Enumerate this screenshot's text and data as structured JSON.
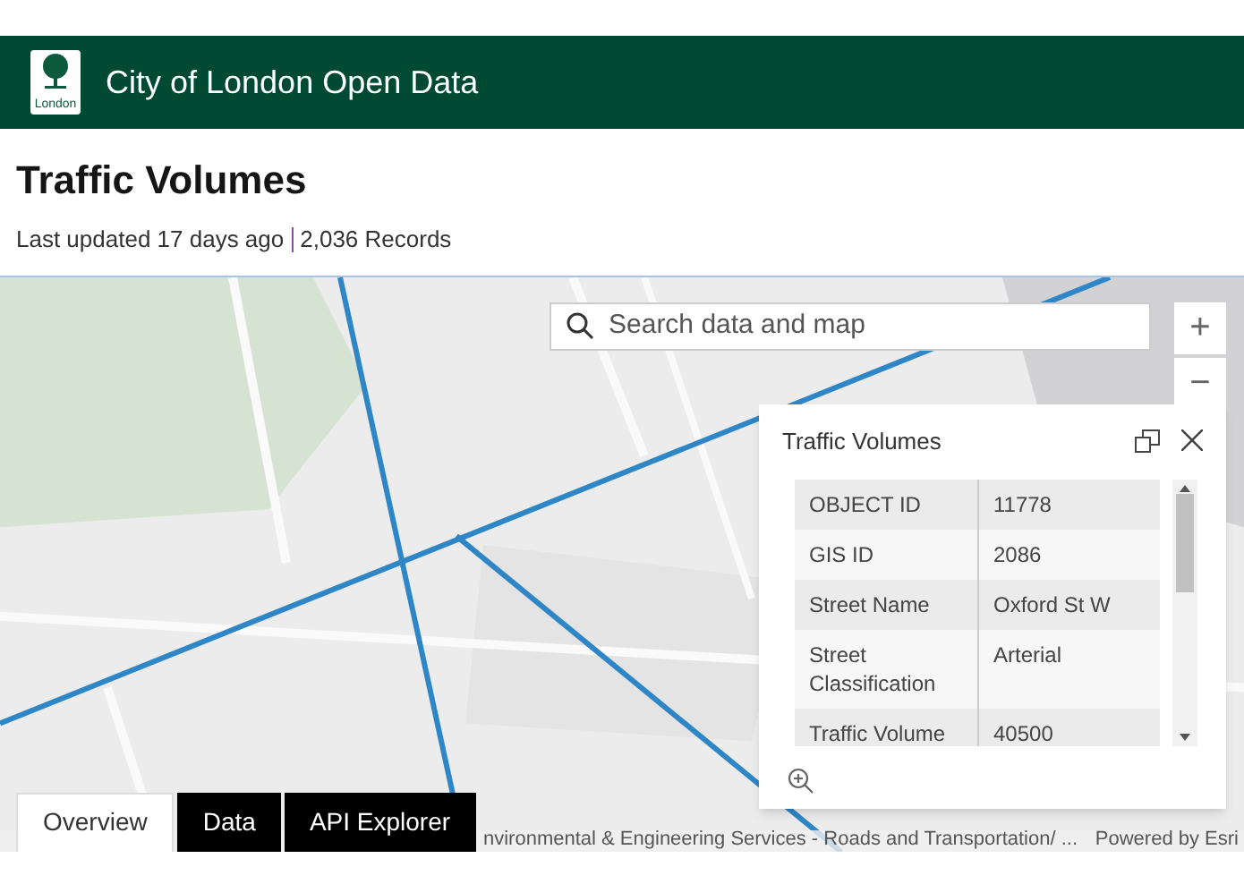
{
  "header": {
    "logo_text": "London",
    "title": "City of London Open Data"
  },
  "page": {
    "title": "Traffic Volumes",
    "updated": "Last updated 17 days ago",
    "records": "2,036 Records"
  },
  "map": {
    "search": {
      "placeholder": "Search data and map"
    },
    "zoom_in": "+",
    "zoom_out": "−",
    "popup": {
      "title": "Traffic Volumes",
      "rows": [
        {
          "label": "OBJECT ID",
          "value": "11778"
        },
        {
          "label": "GIS ID",
          "value": "2086"
        },
        {
          "label": "Street Name",
          "value": "Oxford St W"
        },
        {
          "label": "Street Classification",
          "value": "Arterial"
        },
        {
          "label": "Traffic Volume",
          "value": "40500"
        }
      ]
    },
    "attribution": "nvironmental & Engineering Services - Roads and Transportation/ ...",
    "powered_by": "Powered by Esri"
  },
  "tabs": [
    {
      "label": "Overview",
      "selected": true
    },
    {
      "label": "Data",
      "selected": false
    },
    {
      "label": "API Explorer",
      "selected": false
    }
  ]
}
